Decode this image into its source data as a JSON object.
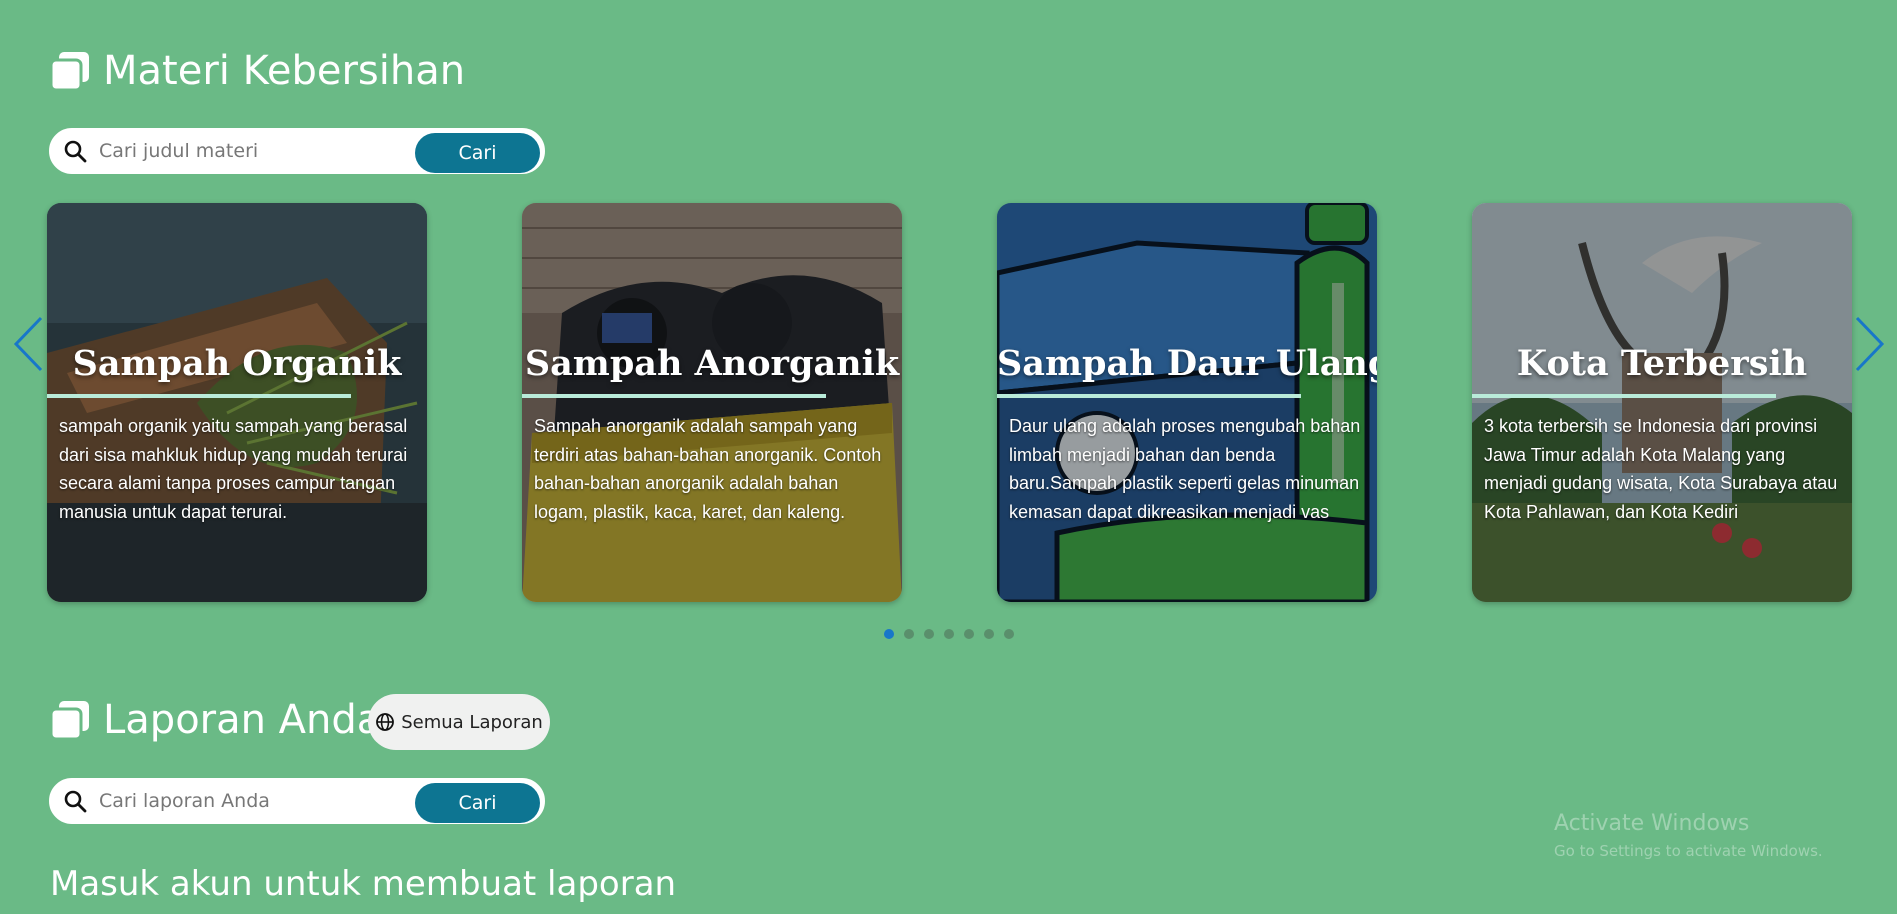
{
  "materi": {
    "title": "Materi Kebersihan",
    "search": {
      "placeholder": "Cari judul materi",
      "button": "Cari"
    },
    "cards": [
      {
        "title": "Sampah Organik",
        "desc": "sampah organik yaitu sampah yang berasal dari sisa mahkluk hidup yang mudah terurai secara alami tanpa proses campur tangan manusia untuk dapat terurai."
      },
      {
        "title": "Sampah Anorganik",
        "desc": "Sampah anorganik adalah sampah yang terdiri atas bahan-bahan anorganik. Contoh bahan-bahan anorganik adalah bahan logam, plastik, kaca, karet, dan kaleng."
      },
      {
        "title": "Sampah Daur Ulang",
        "desc": "Daur ulang adalah proses mengubah bahan limbah menjadi bahan dan benda baru.Sampah plastik seperti gelas minuman kemasan dapat dikreasikan menjadi vas"
      },
      {
        "title": "Kota Terbersih",
        "desc": "3 kota terbersih se Indonesia dari provinsi Jawa Timur adalah Kota Malang yang menjadi gudang wisata, Kota Surabaya atau Kota Pahlawan, dan Kota Kediri"
      }
    ],
    "carousel": {
      "total_slides": 7,
      "active_slide": 1
    }
  },
  "laporan": {
    "title": "Laporan Anda",
    "all_button": "Semua Laporan",
    "search": {
      "placeholder": "Cari laporan Anda",
      "button": "Cari"
    }
  },
  "login_message": "Masuk akun untuk membuat laporan",
  "watermark": {
    "title": "Activate Windows",
    "subtitle": "Go to Settings to activate Windows."
  },
  "colors": {
    "background": "#6aba86",
    "button": "#0d7592",
    "arrow": "#1877c9",
    "card_underline": "#b9ebd9"
  },
  "icons": [
    "copy-icon",
    "search-icon",
    "chevron-left-icon",
    "chevron-right-icon",
    "globe-icon"
  ]
}
